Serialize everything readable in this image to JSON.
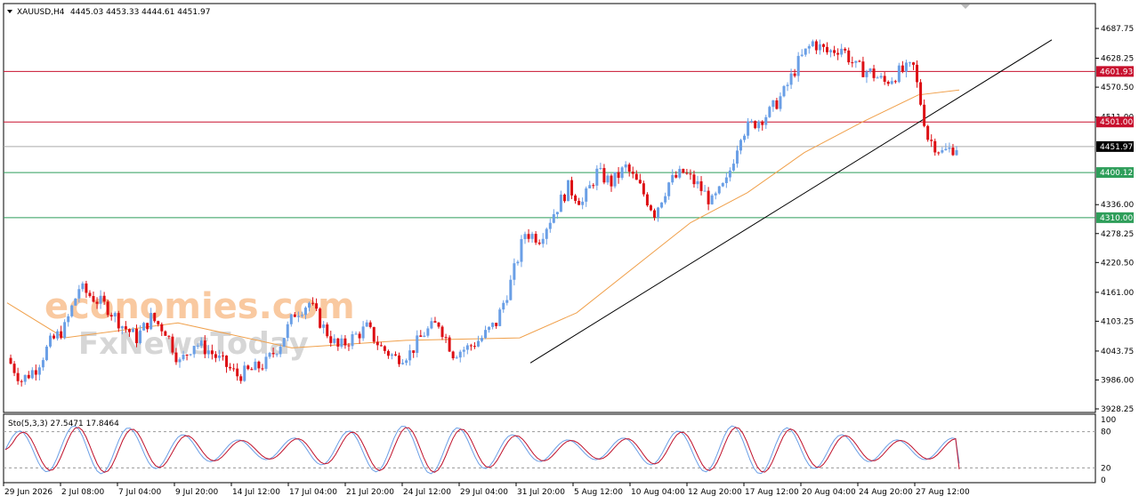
{
  "header": {
    "symbol": "XAUUSD,H4",
    "ohlc": "4445.03 4453.33 4444.61 4451.97"
  },
  "watermark": {
    "line1": "economies.com",
    "line2": "FxNewsToday"
  },
  "colors": {
    "bull": "#6a9fe6",
    "bear": "#dd0f14",
    "ma": "#f0a04b",
    "resistance": "#c8102e",
    "support": "#2e9e5a",
    "current": "#aaaaaa",
    "trend": "#000000",
    "sto_main": "#6a9fe6",
    "sto_signal": "#c0102a"
  },
  "chart_data": [
    {
      "type": "candlestick",
      "title": "XAUUSD,H4",
      "price_axis_ticks": [
        "4687.75",
        "4628.25",
        "4570.50",
        "4511.00",
        "4336.00",
        "4278.25",
        "4220.50",
        "4161.00",
        "4103.25",
        "4043.75",
        "3986.00",
        "3928.25"
      ],
      "ylim": [
        3928.25,
        4715
      ],
      "time_axis_ticks": [
        "29 Jun 2026",
        "2 Jul 08:00",
        "7 Jul 04:00",
        "9 Jul 20:00",
        "14 Jul 12:00",
        "17 Jul 04:00",
        "21 Jul 20:00",
        "24 Jul 12:00",
        "29 Jul 04:00",
        "31 Jul 20:00",
        "5 Aug 12:00",
        "10 Aug 04:00",
        "12 Aug 20:00",
        "17 Aug 12:00",
        "20 Aug 04:00",
        "24 Aug 20:00",
        "27 Aug 12:00"
      ],
      "horizontal_levels": [
        {
          "value": 4601.93,
          "label": "4601.93",
          "kind": "resistance"
        },
        {
          "value": 4501.0,
          "label": "4501.00",
          "kind": "resistance"
        },
        {
          "value": 4451.97,
          "label": "4451.97",
          "kind": "current"
        },
        {
          "value": 4400.12,
          "label": "4400.12",
          "kind": "support"
        },
        {
          "value": 4310.0,
          "label": "4310.00",
          "kind": "support"
        }
      ],
      "trendline": {
        "from": {
          "time": "31 Jul 00:00",
          "price": 4020
        },
        "to": {
          "time": "31 Aug 00:00",
          "price": 4665
        }
      },
      "close_path": [
        [
          "29 Jun 2026",
          4030
        ],
        [
          "30 Jun",
          3985
        ],
        [
          "1 Jul",
          4010
        ],
        [
          "2 Jul 08:00",
          4060
        ],
        [
          "3 Jul",
          4090
        ],
        [
          "4 Jul",
          4170
        ],
        [
          "6 Jul",
          4150
        ],
        [
          "7 Jul 04:00",
          4130
        ],
        [
          "8 Jul",
          4095
        ],
        [
          "9 Jul",
          4070
        ],
        [
          "9 Jul 20:00",
          4110
        ],
        [
          "10 Jul",
          4085
        ],
        [
          "13 Jul",
          4020
        ],
        [
          "14 Jul",
          4060
        ],
        [
          "14 Jul 12:00",
          4045
        ],
        [
          "15 Jul",
          4020
        ],
        [
          "16 Jul",
          3995
        ],
        [
          "17 Jul 04:00",
          4005
        ],
        [
          "17 Jul 16:00",
          4020
        ],
        [
          "20 Jul",
          4060
        ],
        [
          "21 Jul",
          4120
        ],
        [
          "21 Jul 20:00",
          4140
        ],
        [
          "22 Jul",
          4090
        ],
        [
          "23 Jul",
          4050
        ],
        [
          "24 Jul",
          4070
        ],
        [
          "24 Jul 12:00",
          4090
        ],
        [
          "27 Jul",
          4050
        ],
        [
          "28 Jul",
          4030
        ],
        [
          "29 Jul",
          4040
        ],
        [
          "29 Jul 04:00",
          4080
        ],
        [
          "30 Jul",
          4100
        ],
        [
          "30 Jul 12:00",
          4040
        ],
        [
          "31 Jul",
          4050
        ],
        [
          "31 Jul 20:00",
          4070
        ],
        [
          "3 Aug",
          4100
        ],
        [
          "4 Aug",
          4180
        ],
        [
          "5 Aug",
          4280
        ],
        [
          "5 Aug 12:00",
          4270
        ],
        [
          "6 Aug",
          4320
        ],
        [
          "7 Aug",
          4370
        ],
        [
          "8 Aug",
          4340
        ],
        [
          "10 Aug 04:00",
          4400
        ],
        [
          "11 Aug",
          4380
        ],
        [
          "11 Aug 12:00",
          4410
        ],
        [
          "12 Aug",
          4370
        ],
        [
          "12 Aug 20:00",
          4320
        ],
        [
          "13 Aug",
          4380
        ],
        [
          "14 Aug",
          4400
        ],
        [
          "17 Aug",
          4375
        ],
        [
          "17 Aug 12:00",
          4340
        ],
        [
          "18 Aug",
          4380
        ],
        [
          "19 Aug",
          4480
        ],
        [
          "19 Aug 12:00",
          4500
        ],
        [
          "20 Aug",
          4520
        ],
        [
          "20 Aug 04:00",
          4560
        ],
        [
          "21 Aug",
          4620
        ],
        [
          "22 Aug",
          4660
        ],
        [
          "24 Aug",
          4640
        ],
        [
          "24 Aug 20:00",
          4650
        ],
        [
          "25 Aug",
          4610
        ],
        [
          "26 Aug",
          4600
        ],
        [
          "26 Aug 12:00",
          4580
        ],
        [
          "27 Aug",
          4600
        ],
        [
          "27 Aug 12:00",
          4610
        ],
        [
          "28 Aug",
          4470
        ],
        [
          "28 Aug 12:00",
          4440
        ],
        [
          "28 Aug 20:00",
          4452
        ]
      ],
      "moving_average": [
        [
          "29 Jun 2026",
          4140
        ],
        [
          "2 Jul 08:00",
          4070
        ],
        [
          "9 Jul 20:00",
          4100
        ],
        [
          "17 Jul 04:00",
          4050
        ],
        [
          "24 Jul 12:00",
          4065
        ],
        [
          "31 Jul 20:00",
          4070
        ],
        [
          "5 Aug 12:00",
          4120
        ],
        [
          "12 Aug 20:00",
          4300
        ],
        [
          "17 Aug 12:00",
          4360
        ],
        [
          "20 Aug 04:00",
          4440
        ],
        [
          "24 Aug 20:00",
          4500
        ],
        [
          "27 Aug 12:00",
          4555
        ],
        [
          "28 Aug 20:00",
          4565
        ]
      ],
      "last_price": 4451.97
    },
    {
      "type": "line",
      "title": "Sto(5,3,3) 27.5471 17.8464",
      "indicator": "Stochastic (5,3,3)",
      "ylim": [
        0,
        100
      ],
      "levels": [
        20,
        80
      ],
      "axis_ticks": [
        "100",
        "80",
        "20",
        "0"
      ],
      "series": [
        {
          "name": "Main",
          "last_value": 27.5471
        },
        {
          "name": "Signal",
          "last_value": 17.8464
        }
      ]
    }
  ]
}
